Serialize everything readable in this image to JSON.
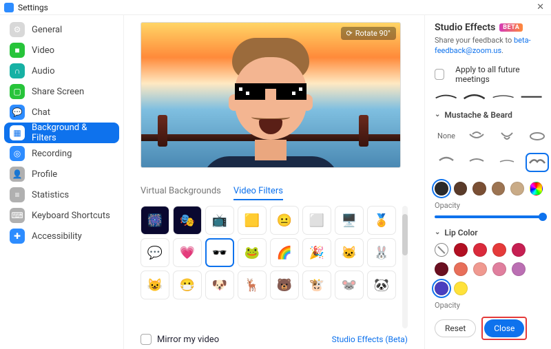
{
  "window": {
    "title": "Settings",
    "close_glyph": "✕"
  },
  "sidebar": {
    "items": [
      {
        "label": "General",
        "icon": "gear",
        "color": "#d8d8d8"
      },
      {
        "label": "Video",
        "icon": "video",
        "color": "#27c43a"
      },
      {
        "label": "Audio",
        "icon": "audio",
        "color": "#17b1a4"
      },
      {
        "label": "Share Screen",
        "icon": "screen",
        "color": "#27c43a"
      },
      {
        "label": "Chat",
        "icon": "chat",
        "color": "#2d8cff"
      },
      {
        "label": "Background & Filters",
        "icon": "bgfilter",
        "color": "#0e72ed",
        "selected": true
      },
      {
        "label": "Recording",
        "icon": "record",
        "color": "#2d8cff"
      },
      {
        "label": "Profile",
        "icon": "profile",
        "color": "#b0b0b0"
      },
      {
        "label": "Statistics",
        "icon": "stats",
        "color": "#b0b0b0"
      },
      {
        "label": "Keyboard Shortcuts",
        "icon": "keyboard",
        "color": "#b0b0b0"
      },
      {
        "label": "Accessibility",
        "icon": "a11y",
        "color": "#2d8cff"
      }
    ]
  },
  "preview": {
    "rotate_label": "Rotate 90°"
  },
  "center_tabs": {
    "virtual_backgrounds": "Virtual Backgrounds",
    "video_filters": "Video Filters",
    "active": "video_filters"
  },
  "filters": {
    "selected_index": 10,
    "items": [
      "🎆",
      "🎭",
      "📺",
      "🟨",
      "😐",
      "⬜",
      "🖥️",
      "🏅",
      "💬",
      "💗",
      "🕶️",
      "🐸",
      "🌈",
      "🎉",
      "🐱",
      "🐰",
      "😺",
      "😷",
      "🐶",
      "🦌",
      "🐻",
      "🐮",
      "🐭",
      "🐼"
    ]
  },
  "mirror": {
    "label": "Mirror my video",
    "checked": false
  },
  "studio_link": "Studio Effects (Beta)",
  "right": {
    "title": "Studio Effects",
    "beta": "BETA",
    "feedback_prefix": "Share your feedback to  ",
    "feedback_link": "beta-feedback@zoom.us",
    "feedback_suffix": ".",
    "apply_all": "Apply to all future meetings",
    "sections": {
      "mustache": {
        "title": "Mustache & Beard",
        "none_label": "None",
        "selected_index": 7,
        "colors": [
          "#2b2a2a",
          "#5a3b2a",
          "#7a4f34",
          "#9c7452",
          "#c9ab87",
          "rainbow"
        ],
        "selected_color": 0,
        "opacity_label": "Opacity",
        "opacity": 100
      },
      "lip": {
        "title": "Lip Color",
        "colors": [
          "none",
          "#b20f22",
          "#da2a3b",
          "#e53a3a",
          "#c61f52",
          "#6a0f20",
          "#e86f5a",
          "#f09990",
          "#e07f9e",
          "#bb6fb3",
          "#4a3fbf",
          "#ffe23a"
        ],
        "selected_index": 10,
        "opacity_label": "Opacity"
      }
    },
    "reset": "Reset",
    "close": "Close"
  }
}
